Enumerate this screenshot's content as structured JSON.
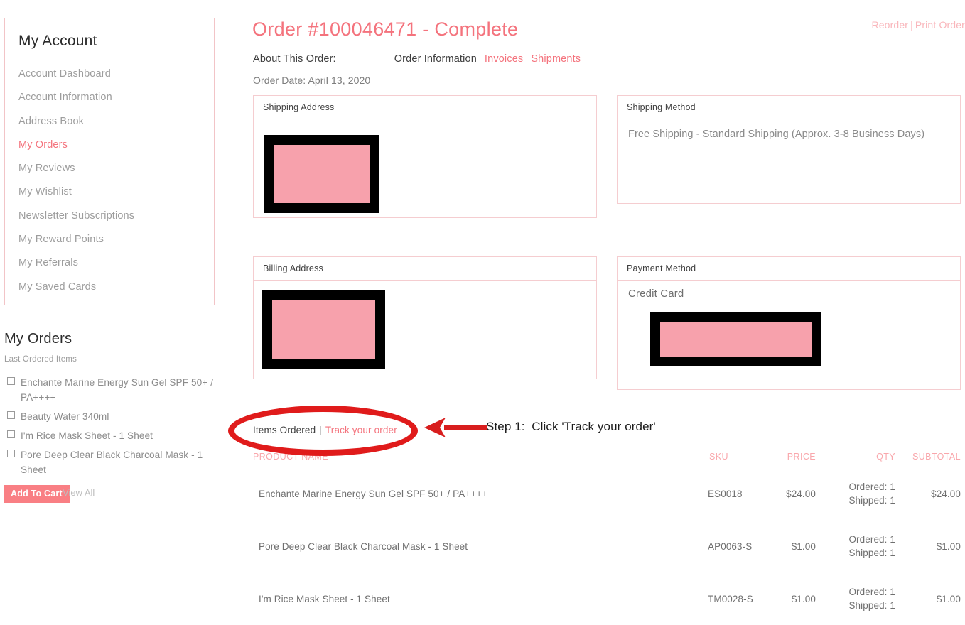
{
  "sidebar": {
    "account_title": "My Account",
    "items": [
      {
        "label": "Account Dashboard",
        "active": false
      },
      {
        "label": "Account Information",
        "active": false
      },
      {
        "label": "Address Book",
        "active": false
      },
      {
        "label": "My Orders",
        "active": true
      },
      {
        "label": "My Reviews",
        "active": false
      },
      {
        "label": "My Wishlist",
        "active": false
      },
      {
        "label": "Newsletter Subscriptions",
        "active": false
      },
      {
        "label": "My Reward Points",
        "active": false
      },
      {
        "label": "My Referrals",
        "active": false
      },
      {
        "label": "My Saved Cards",
        "active": false
      }
    ],
    "orders_heading": "My Orders",
    "last_ordered_label": "Last Ordered Items",
    "last_ordered_items": [
      "Enchante Marine Energy Sun Gel SPF 50+ / PA++++",
      "Beauty Water 340ml",
      "I'm Rice Mask Sheet - 1 Sheet",
      "Pore Deep Clear Black Charcoal Mask - 1 Sheet"
    ],
    "add_to_cart_label": "Add To Cart",
    "view_all_label": "View All"
  },
  "header": {
    "order_title": "Order #100046471 - Complete",
    "reorder_label": "Reorder",
    "separator": "|",
    "print_order_label": "Print Order",
    "about_label": "About This Order:",
    "tab_order_information": "Order Information",
    "tab_invoices": "Invoices",
    "tab_shipments": "Shipments",
    "order_date": "Order Date: April 13, 2020"
  },
  "panels": {
    "shipping_address_title": "Shipping Address",
    "shipping_method_title": "Shipping Method",
    "shipping_method_value": "Free Shipping - Standard Shipping (Approx. 3-8 Business Days)",
    "billing_address_title": "Billing Address",
    "payment_method_title": "Payment Method",
    "payment_method_value": "Credit Card"
  },
  "items_ordered": {
    "label": "Items Ordered",
    "separator": "|",
    "track_link": "Track your order"
  },
  "annotation": {
    "step_text": "Step 1:  Click 'Track your order'"
  },
  "table": {
    "headers": {
      "name": "PRODUCT NAME",
      "sku": "SKU",
      "price": "PRICE",
      "qty": "QTY",
      "subtotal": "SUBTOTAL"
    },
    "rows": [
      {
        "name": "Enchante Marine Energy Sun Gel SPF 50+ / PA++++",
        "sku": "ES0018",
        "price": "$24.00",
        "qty_ordered": "Ordered: 1",
        "qty_shipped": "Shipped: 1",
        "subtotal": "$24.00"
      },
      {
        "name": "Pore Deep Clear Black Charcoal Mask - 1 Sheet",
        "sku": "AP0063-S",
        "price": "$1.00",
        "qty_ordered": "Ordered: 1",
        "qty_shipped": "Shipped: 1",
        "subtotal": "$1.00"
      },
      {
        "name": "I'm Rice Mask Sheet - 1 Sheet",
        "sku": "TM0028-S",
        "price": "$1.00",
        "qty_ordered": "Ordered: 1",
        "qty_shipped": "Shipped: 1",
        "subtotal": "$1.00"
      }
    ]
  },
  "colors": {
    "accent_pink": "#f4737d",
    "light_pink_border": "#f5cdd0",
    "button_coral": "#f97f84",
    "annotation_red": "#e01b1b",
    "redaction_pink": "#f7a1ac"
  }
}
